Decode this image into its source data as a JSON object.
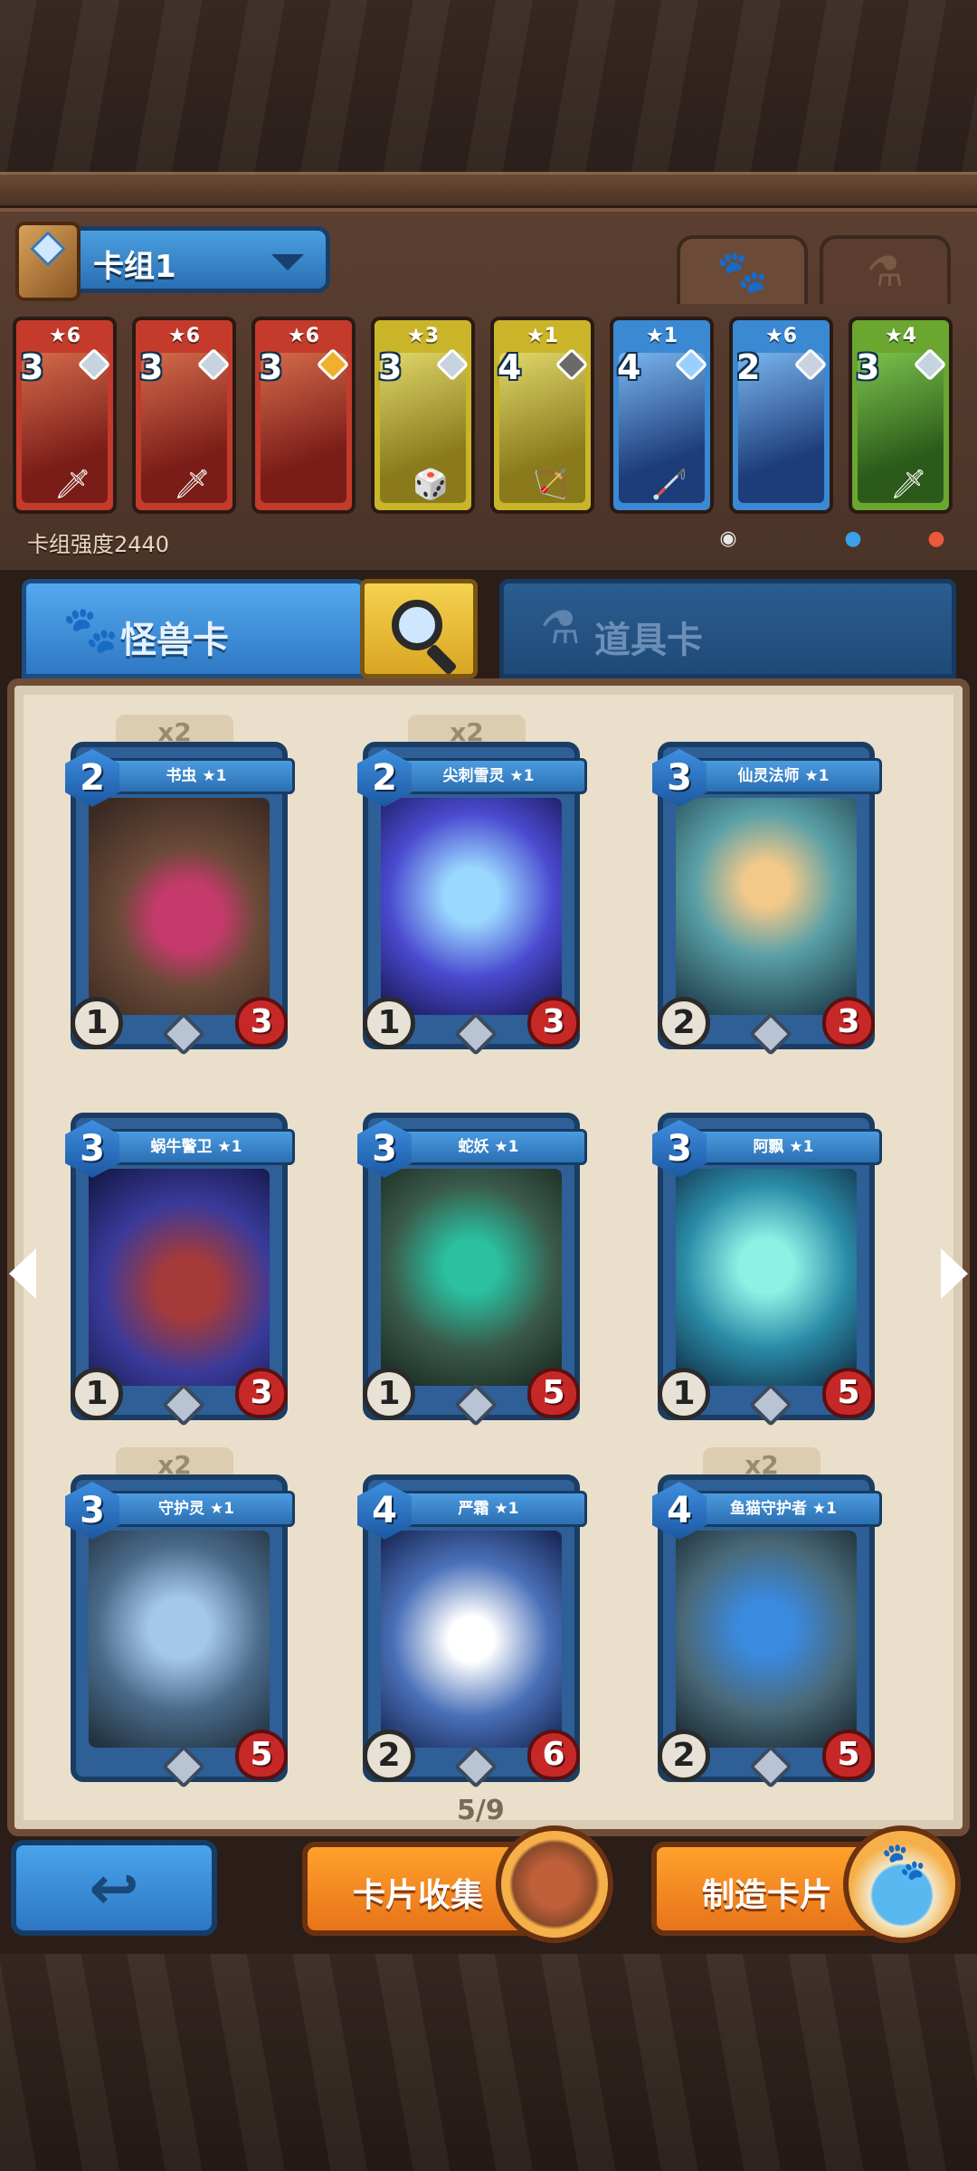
{
  "deck": {
    "name": "卡组1",
    "power_label": "卡组强度2440",
    "tabs": [
      {
        "icon": "paw-icon",
        "glyph": "🐾",
        "active": true
      },
      {
        "icon": "flask-icon",
        "glyph": "⚗",
        "active": false
      }
    ],
    "cards": [
      {
        "stars": "★6",
        "cost": "3",
        "color": "red",
        "gem": "silver",
        "weapon": "🗡"
      },
      {
        "stars": "★6",
        "cost": "3",
        "color": "red",
        "gem": "silver",
        "weapon": "🗡"
      },
      {
        "stars": "★6",
        "cost": "3",
        "color": "red",
        "gem": "gold",
        "weapon": ""
      },
      {
        "stars": "★3",
        "cost": "3",
        "color": "yellow",
        "gem": "silver",
        "weapon": "🎲"
      },
      {
        "stars": "★1",
        "cost": "4",
        "color": "yellow",
        "gem": "dark",
        "weapon": "🏹"
      },
      {
        "stars": "★1",
        "cost": "4",
        "color": "blue",
        "gem": "rainbow",
        "weapon": "🦯"
      },
      {
        "stars": "★6",
        "cost": "2",
        "color": "blue",
        "gem": "silver",
        "weapon": ""
      },
      {
        "stars": "★4",
        "cost": "3",
        "color": "green",
        "gem": "silver",
        "weapon": "🗡"
      }
    ],
    "filters": [
      {
        "icon": "all-filter-icon",
        "glyph": "◉",
        "color": "#e8e8e8"
      },
      {
        "icon": "mushroom-filter-icon",
        "glyph": "●",
        "color": "#4a3529"
      },
      {
        "icon": "hand-filter-icon",
        "glyph": "●",
        "color": "#4a3529"
      },
      {
        "icon": "water-filter-icon",
        "glyph": "●",
        "color": "#3aa0e8"
      },
      {
        "icon": "bird-filter-icon",
        "glyph": "●",
        "color": "#4a3529"
      },
      {
        "icon": "fire-filter-icon",
        "glyph": "●",
        "color": "#e85a3a"
      }
    ]
  },
  "categories": {
    "monster_label": "怪兽卡",
    "items_label": "道具卡"
  },
  "collection": {
    "page": "5/9",
    "cards": [
      {
        "name": "书虫 ★1",
        "mana": "2",
        "attack": "1",
        "hp": "3",
        "count": "x2",
        "art": "worm"
      },
      {
        "name": "尖刺雪灵 ★1",
        "mana": "2",
        "attack": "1",
        "hp": "3",
        "count": "x2",
        "art": "snow"
      },
      {
        "name": "仙灵法师 ★1",
        "mana": "3",
        "attack": "2",
        "hp": "3",
        "count": "",
        "art": "fairy"
      },
      {
        "name": "蜗牛警卫 ★1",
        "mana": "3",
        "attack": "1",
        "hp": "3",
        "count": "",
        "art": "snail"
      },
      {
        "name": "蛇妖 ★1",
        "mana": "3",
        "attack": "1",
        "hp": "5",
        "count": "",
        "art": "snake"
      },
      {
        "name": "阿飘 ★1",
        "mana": "3",
        "attack": "1",
        "hp": "5",
        "count": "",
        "art": "ghost"
      },
      {
        "name": "守护灵 ★1",
        "mana": "3",
        "attack": "",
        "hp": "5",
        "count": "x2",
        "art": "guard"
      },
      {
        "name": "严霜 ★1",
        "mana": "4",
        "attack": "2",
        "hp": "6",
        "count": "",
        "art": "frost"
      },
      {
        "name": "鱼猫守护者 ★1",
        "mana": "4",
        "attack": "2",
        "hp": "5",
        "count": "x2",
        "art": "cat"
      }
    ]
  },
  "buttons": {
    "back_icon": "↩",
    "collect_label": "卡片收集",
    "craft_label": "制造卡片"
  }
}
